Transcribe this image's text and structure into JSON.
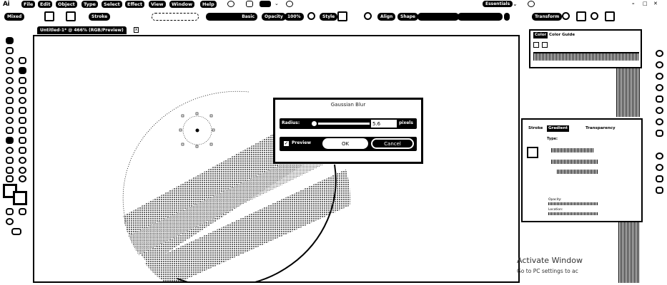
{
  "app": {
    "logo": "Ai"
  },
  "menu": {
    "items": [
      "File",
      "Edit",
      "Object",
      "Type",
      "Select",
      "Effect",
      "View",
      "Window",
      "Help"
    ],
    "workspace": "Essentials"
  },
  "control_bar": {
    "selection_label": "Mixed",
    "stroke_label": "Stroke",
    "brush_label": "Basic",
    "opacity_label": "Opacity",
    "opacity_value": "100%",
    "style_label": "Style",
    "align_label": "Align",
    "shape_label": "Shape",
    "transform_label": "Transform"
  },
  "document": {
    "tab_title": "Untitled-1* @ 466% (RGB/Preview)",
    "close_glyph": "x"
  },
  "gaussian_blur": {
    "title": "Gaussian Blur",
    "radius_label": "Radius:",
    "radius_value": "5.6",
    "radius_unit": "pixels",
    "preview_label": "Preview",
    "preview_checked": true,
    "ok_label": "OK",
    "cancel_label": "Cancel"
  },
  "panels": {
    "color": {
      "tabs": [
        "Color",
        "Color Guide"
      ]
    },
    "gradient": {
      "tabs": [
        "Stroke",
        "Gradient",
        "Transparency"
      ],
      "type_label": "Type:",
      "opacity_label": "Opacity:",
      "location_label": "Location:"
    }
  },
  "watermark": {
    "title": "Activate Window",
    "subtitle": "Go to PC settings to ac"
  }
}
